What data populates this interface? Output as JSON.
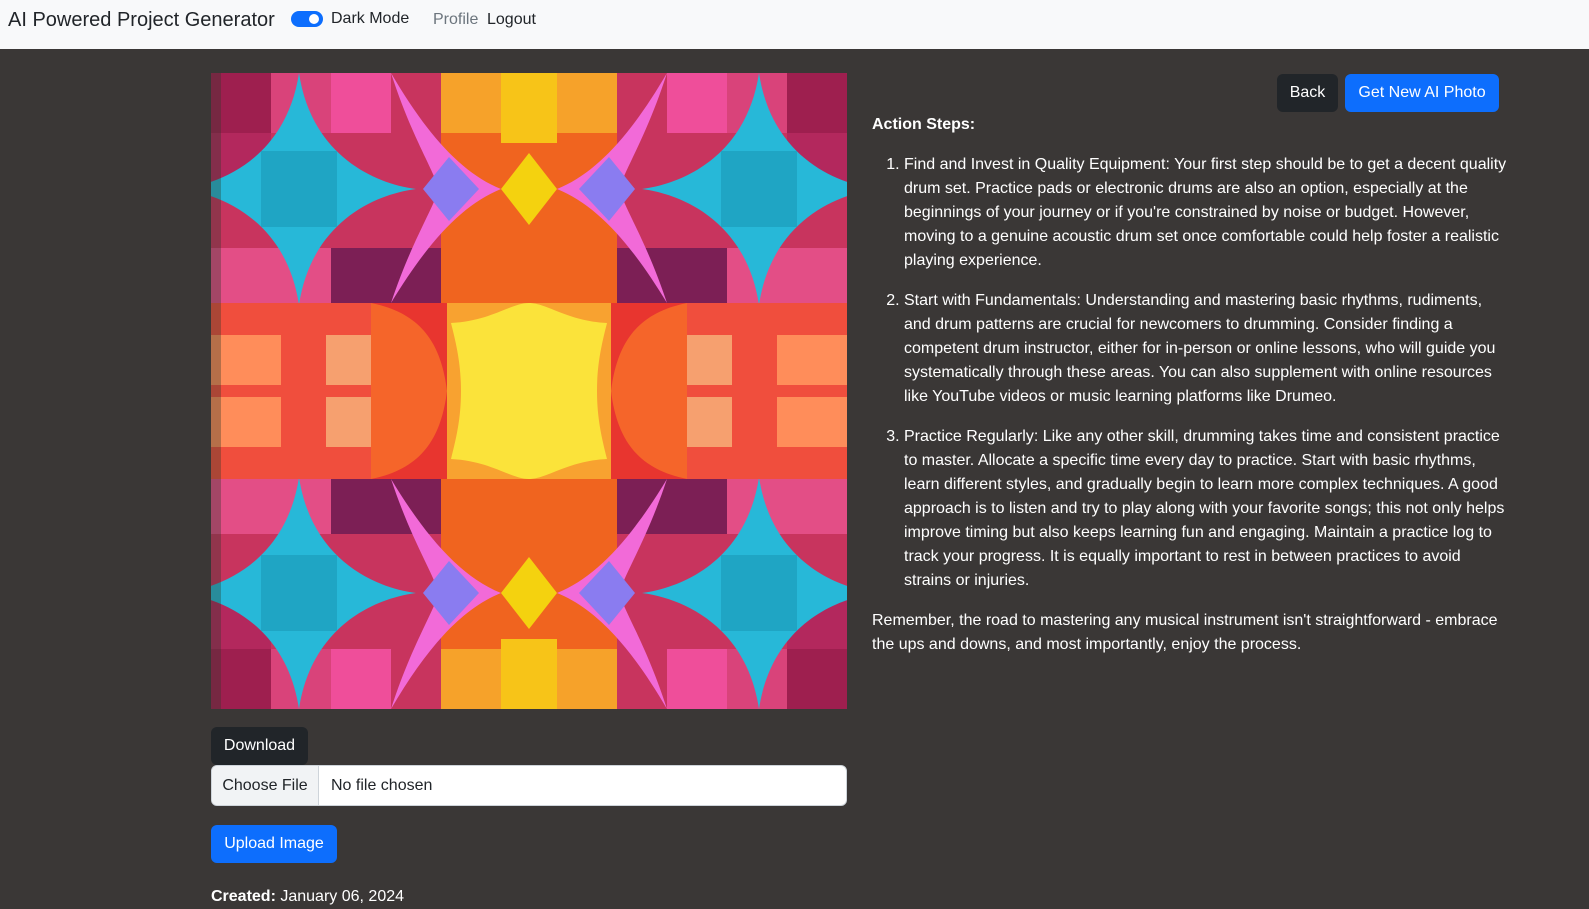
{
  "navbar": {
    "brand": "AI Powered Project Generator",
    "dark_mode_label": "Dark Mode",
    "dark_mode_on": true,
    "profile": "Profile",
    "logout": "Logout"
  },
  "image_panel": {
    "download_label": "Download",
    "file_choose_label": "Choose File",
    "file_status": "No file chosen",
    "upload_label": "Upload Image",
    "created_label": "Created:",
    "created_value": "January 06, 2024"
  },
  "actions": {
    "back_label": "Back",
    "new_photo_label": "Get New AI Photo"
  },
  "content": {
    "heading": "Action Steps:",
    "steps": [
      "Find and Invest in Quality Equipment: Your first step should be to get a decent quality drum set. Practice pads or electronic drums are also an option, especially at the beginnings of your journey or if you're constrained by noise or budget. However, moving to a genuine acoustic drum set once comfortable could help foster a realistic playing experience.",
      "Start with Fundamentals: Understanding and mastering basic rhythms, rudiments, and drum patterns are crucial for newcomers to drumming. Consider finding a competent drum instructor, either for in-person or online lessons, who will guide you systematically through these areas. You can also supplement with online resources like YouTube videos or music learning platforms like Drumeo.",
      "Practice Regularly: Like any other skill, drumming takes time and consistent practice to master. Allocate a specific time every day to practice. Start with basic rhythms, learn different styles, and gradually begin to learn more complex techniques. A good approach is to listen and try to play along with your favorite songs; this not only helps improve timing but also keeps learning fun and engaging. Maintain a practice log to track your progress. It is equally important to rest in between practices to avoid strains or injuries."
    ],
    "closing": "Remember, the road to mastering any musical instrument isn't straightforward - embrace the ups and downs, and most importantly, enjoy the process."
  },
  "colors": {
    "background": "#3a3736",
    "primary": "#0d6efd",
    "dark_button": "#212529"
  }
}
